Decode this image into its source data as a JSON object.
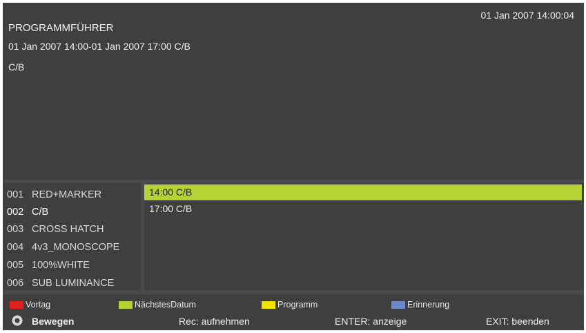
{
  "header": {
    "clock": "01 Jan 2007 14:00:04",
    "title": "PROGRAMMFÜHRER",
    "time_range": "01 Jan 2007 14:00-01 Jan 2007 17:00 C/B",
    "description": "C/B"
  },
  "channels": [
    {
      "num": "001",
      "name": "RED+MARKER"
    },
    {
      "num": "002",
      "name": "C/B"
    },
    {
      "num": "003",
      "name": "CROSS HATCH"
    },
    {
      "num": "004",
      "name": "4v3_MONOSCOPE"
    },
    {
      "num": "005",
      "name": "100%WHITE"
    },
    {
      "num": "006",
      "name": "SUB LUMINANCE"
    }
  ],
  "events": [
    {
      "label": "14:00 C/B"
    },
    {
      "label": "17:00 C/B"
    }
  ],
  "legend": {
    "red": {
      "label": "Vortag",
      "color": "#e02020"
    },
    "green": {
      "label": "NächstesDatum",
      "color": "#b5d334"
    },
    "yellow": {
      "label": "Programm",
      "color": "#f2e200"
    },
    "blue": {
      "label": "Erinnerung",
      "color": "#6f86c9"
    }
  },
  "hints": {
    "move": "Bewegen",
    "rec": "Rec: aufnehmen",
    "enter": "ENTER: anzeige",
    "exit": "EXIT: beenden"
  },
  "icons": {
    "move": "dpad-icon"
  }
}
